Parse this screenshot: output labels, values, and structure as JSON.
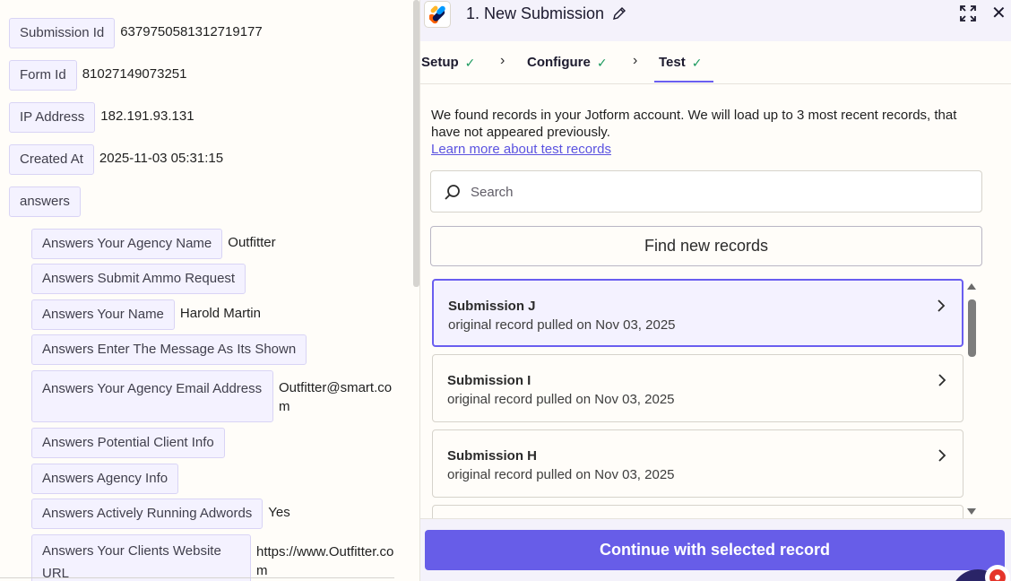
{
  "left_panel": {
    "fields": [
      {
        "key": "Submission Id",
        "value": "6379750581312719177"
      },
      {
        "key": "Form Id",
        "value": "81027149073251"
      },
      {
        "key": "IP Address",
        "value": "182.191.93.131"
      },
      {
        "key": "Created At",
        "value": "2025-11-03 05:31:15"
      },
      {
        "key": "answers",
        "value": ""
      }
    ],
    "answers": [
      {
        "key": "Answers Your Agency Name",
        "value": "Outfitter"
      },
      {
        "key": "Answers Submit Ammo Request",
        "value": ""
      },
      {
        "key": "Answers Your Name",
        "value": "Harold Martin"
      },
      {
        "key": "Answers Enter The Message As Its Shown",
        "value": ""
      },
      {
        "key": "Answers Your Agency Email Address",
        "value": "Outfitter@smart.com"
      },
      {
        "key": "Answers Potential Client Info",
        "value": ""
      },
      {
        "key": "Answers Agency Info",
        "value": ""
      },
      {
        "key": "Answers Actively Running Adwords",
        "value": "Yes"
      },
      {
        "key": "Answers Your Clients Website URL",
        "value": "https://www.Outfitter.com"
      }
    ]
  },
  "drawer": {
    "title": "1. New Submission",
    "tabs": [
      {
        "label": "Setup",
        "done": "✓"
      },
      {
        "label": "Configure",
        "done": "✓"
      },
      {
        "label": "Test",
        "done": "✓"
      }
    ],
    "intro": "We found records in your Jotform account. We will load up to 3 most recent records, that have not appeared previously.",
    "learn_more": "Learn more about test records",
    "search": {
      "placeholder": "Search",
      "value": ""
    },
    "find_button": "Find new records",
    "records": [
      {
        "name": "Submission J",
        "sub": "original record pulled on Nov 03, 2025",
        "selected": true
      },
      {
        "name": "Submission I",
        "sub": "original record pulled on Nov 03, 2025",
        "selected": false
      },
      {
        "name": "Submission H",
        "sub": "original record pulled on Nov 03, 2025",
        "selected": false
      }
    ],
    "continue_button": "Continue with selected record"
  },
  "icons": {
    "app_logo": "jotform-logo-icon",
    "edit": "pencil-icon",
    "expand": "expand-icon",
    "close": "close-icon",
    "search": "search-icon",
    "record_chevron": "chevron-right-icon"
  },
  "colors": {
    "accent": "#675de8",
    "check": "#1c9a5f",
    "key_bg": "#f4f2ff"
  }
}
